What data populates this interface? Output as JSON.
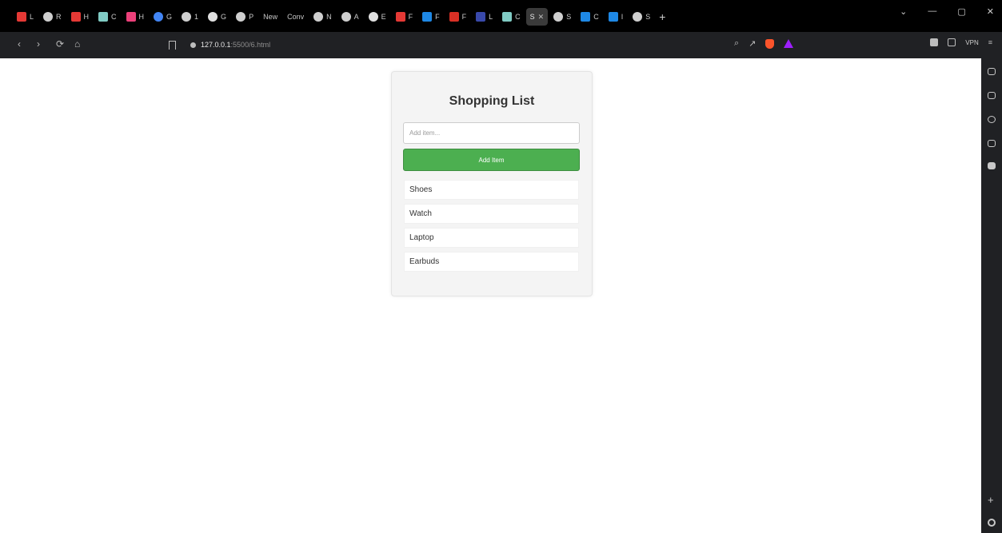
{
  "browser": {
    "tabs": [
      {
        "label": "L",
        "color": "#e53935",
        "shape": "square"
      },
      {
        "label": "R",
        "color": "#cfcfcf",
        "shape": "round"
      },
      {
        "label": "H",
        "color": "#e53935",
        "shape": "square"
      },
      {
        "label": "C",
        "color": "#80cbc4",
        "shape": "square"
      },
      {
        "label": "H",
        "color": "#ec407a",
        "shape": "square"
      },
      {
        "label": "G",
        "color": "#4285f4",
        "shape": "round"
      },
      {
        "label": "1",
        "color": "#cfcfcf",
        "shape": "round"
      },
      {
        "label": "G",
        "color": "#e0e0e0",
        "shape": "round"
      },
      {
        "label": "P",
        "color": "#cfcfcf",
        "shape": "round"
      },
      {
        "label": "New",
        "color": "",
        "shape": "none"
      },
      {
        "label": "Conv",
        "color": "",
        "shape": "none"
      },
      {
        "label": "N",
        "color": "#cfcfcf",
        "shape": "round"
      },
      {
        "label": "A",
        "color": "#cfcfcf",
        "shape": "round"
      },
      {
        "label": "E",
        "color": "#e0e0e0",
        "shape": "round"
      },
      {
        "label": "F",
        "color": "#e53935",
        "shape": "square"
      },
      {
        "label": "F",
        "color": "#1e88e5",
        "shape": "square"
      },
      {
        "label": "F",
        "color": "#d93025",
        "shape": "square"
      },
      {
        "label": "L",
        "color": "#3949ab",
        "shape": "square"
      },
      {
        "label": "C",
        "color": "#80cbc4",
        "shape": "square"
      },
      {
        "label": "S",
        "color": "",
        "shape": "none",
        "active": true
      },
      {
        "label": "S",
        "color": "#cfcfcf",
        "shape": "round"
      },
      {
        "label": "C",
        "color": "#1e88e5",
        "shape": "square"
      },
      {
        "label": "I",
        "color": "#1e88e5",
        "shape": "square"
      },
      {
        "label": "S",
        "color": "#cfcfcf",
        "shape": "round"
      }
    ],
    "new_tab": "+",
    "window_controls": {
      "minimize": "—",
      "maximize": "▢",
      "close": "✕",
      "menu": "⌄"
    },
    "url_host": "127.0.0.1",
    "url_path": ":5500/6.html",
    "vpn_label": "VPN",
    "colors": {
      "chrome_dark": "#000000",
      "toolbar": "#202124"
    }
  },
  "app": {
    "title": "Shopping List",
    "input_placeholder": "Add item...",
    "input_value": "",
    "add_button_label": "Add Item",
    "items": [
      "Shoes",
      "Watch",
      "Laptop",
      "Earbuds"
    ],
    "colors": {
      "accent": "#4caf50",
      "card": "#f4f4f4"
    }
  }
}
